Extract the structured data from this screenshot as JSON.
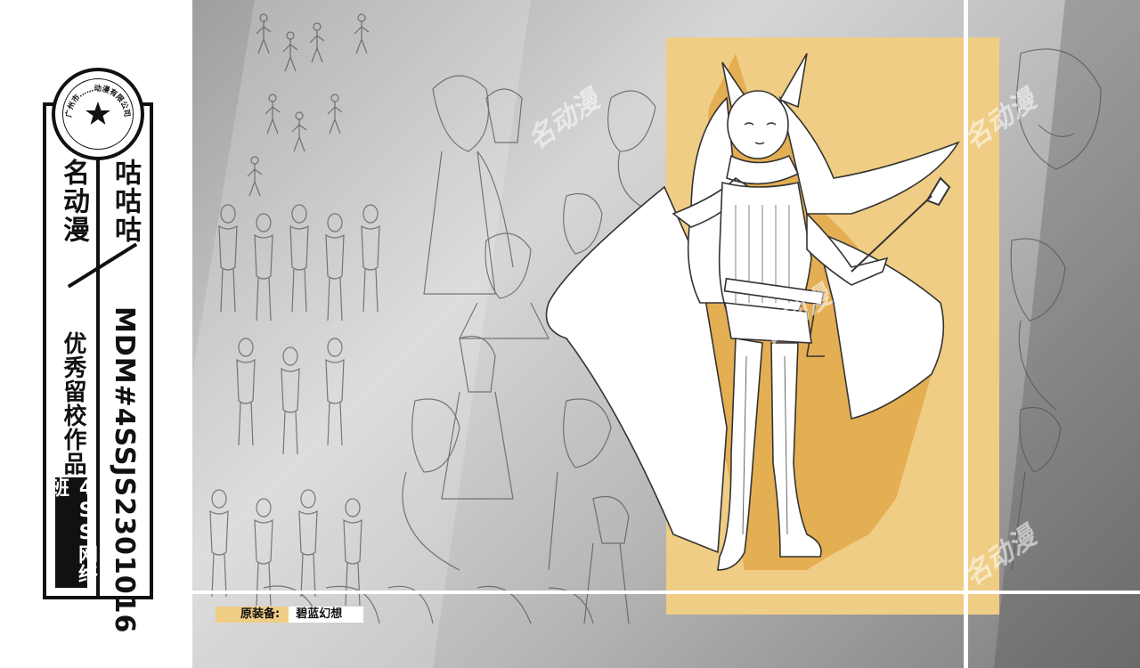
{
  "badge": {
    "seal_text": "广州市……动漫有限公司",
    "name_left": "名动漫",
    "name_right": "咕咕咕",
    "program": "优秀留校作品",
    "class_tag": "4SS网络班",
    "code": "MDM#4SSJS2301016"
  },
  "caption": {
    "label": "原装备:",
    "value": "碧蓝幻想"
  },
  "watermarks": [
    "名动漫",
    "名动漫",
    "名动漫",
    "名动漫"
  ],
  "colors": {
    "accent": "#f0cd84",
    "accent_dark": "#e2a84a",
    "ink": "#111111"
  }
}
